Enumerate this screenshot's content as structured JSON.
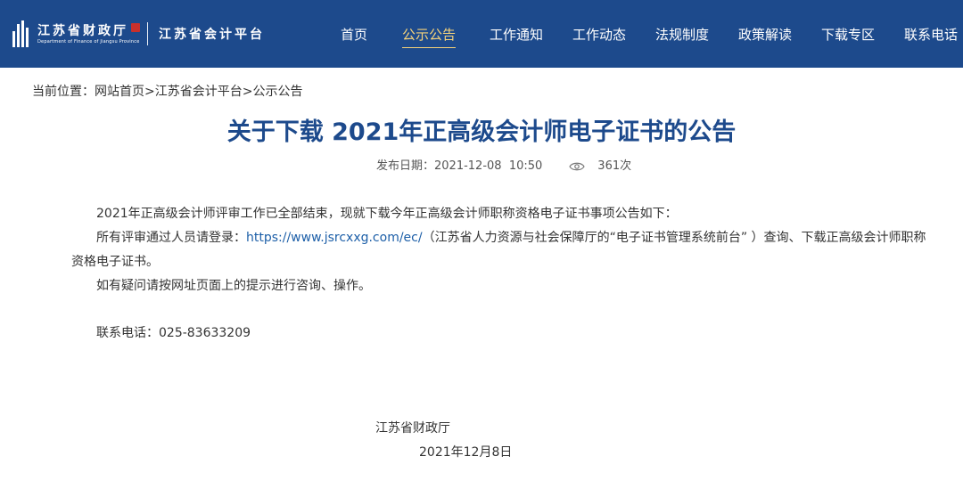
{
  "header": {
    "logo_cn": "江苏省财政厅",
    "logo_en": "Department of Finance of Jiangsu Province",
    "platform": "江苏省会计平台",
    "bg_color": "#1d4a8c",
    "active_color": "#f5d27a"
  },
  "nav": {
    "items": [
      {
        "label": "首页"
      },
      {
        "label": "公示公告",
        "active": true
      },
      {
        "label": "工作通知"
      },
      {
        "label": "工作动态"
      },
      {
        "label": "法规制度"
      },
      {
        "label": "政策解读"
      },
      {
        "label": "下载专区"
      },
      {
        "label": "联系电话"
      }
    ]
  },
  "breadcrumb": {
    "prefix": "当前位置：",
    "home": "网站首页",
    "sep1": ">",
    "platform": "江苏省会计平台",
    "sep2": ">",
    "current": "公示公告"
  },
  "article": {
    "title": "关于下载 2021年正高级会计师电子证书的公告",
    "date_label": "发布日期：",
    "date": "2021-12-08  10:50",
    "views_icon": "eye-icon",
    "views": "361次",
    "p1": "2021年正高级会计师评审工作已全部结束，现就下载今年正高级会计师职称资格电子证书事项公告如下：",
    "p2_before": "所有评审通过人员请登录：",
    "p2_link": "https://www.jsrcxxg.com/ec/",
    "p2_after": "（江苏省人力资源与社会保障厅的“电子证书管理系统前台” ）查询、下载正高级会计师职称资格电子证书。",
    "p3": "如有疑问请按网址页面上的提示进行咨询、操作。",
    "contact_label": "联系电话：",
    "contact_phone": "025-83633209",
    "signature": "江苏省财政厅",
    "sign_date": "2021年12月8日"
  }
}
